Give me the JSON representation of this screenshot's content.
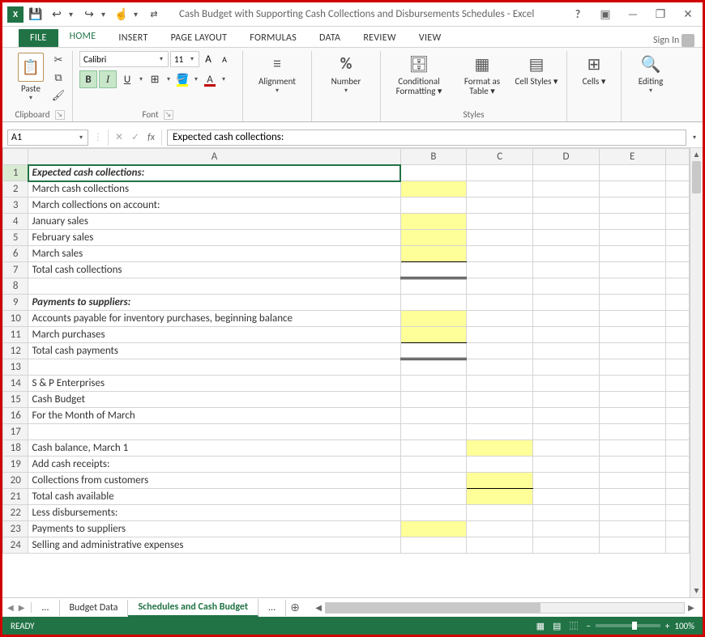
{
  "titlebar": {
    "doc_title": "Cash Budget with Supporting Cash Collections and Disbursements Schedules - Excel",
    "help": "?"
  },
  "ribbon": {
    "tabs": {
      "file": "FILE",
      "home": "HOME",
      "insert": "INSERT",
      "page_layout": "PAGE LAYOUT",
      "formulas": "FORMULAS",
      "data": "DATA",
      "review": "REVIEW",
      "view": "VIEW"
    },
    "sign_in": "Sign In",
    "clipboard": {
      "paste": "Paste",
      "label": "Clipboard"
    },
    "font": {
      "name": "Calibri",
      "size": "11",
      "label": "Font",
      "inc_a": "A",
      "dec_a": "A",
      "bold": "B",
      "italic": "I",
      "underline": "U"
    },
    "alignment": {
      "label": "Alignment"
    },
    "number": {
      "label": "Number",
      "percent": "%"
    },
    "styles": {
      "conditional": "Conditional Formatting ▾",
      "format_table": "Format as Table ▾",
      "cell_styles": "Cell Styles ▾",
      "label": "Styles"
    },
    "cells": {
      "label": "Cells",
      "btn": "Cells ▾"
    },
    "editing": {
      "label": "Editing",
      "btn": "Editing"
    }
  },
  "formula_bar": {
    "name_box": "A1",
    "fx": "fx",
    "value": "Expected cash collections:"
  },
  "columns": {
    "A": "A",
    "B": "B",
    "C": "C",
    "D": "D",
    "E": "E"
  },
  "rows_a": [
    "Expected cash collections:",
    "March cash collections",
    "March collections on account:",
    "January sales",
    "February sales",
    "March sales",
    "Total cash collections",
    "",
    "Payments to suppliers:",
    "Accounts payable for inventory purchases, beginning balance",
    "March purchases",
    "Total cash payments",
    "",
    "S & P Enterprises",
    "Cash Budget",
    "For the Month of March",
    "",
    "Cash balance, March 1",
    "Add cash receipts:",
    "Collections from customers",
    "Total cash available",
    "Less disbursements:",
    "Payments to suppliers",
    "Selling and administrative expenses"
  ],
  "row_numbers": [
    "1",
    "2",
    "3",
    "4",
    "5",
    "6",
    "7",
    "8",
    "9",
    "10",
    "11",
    "12",
    "13",
    "14",
    "15",
    "16",
    "17",
    "18",
    "19",
    "20",
    "21",
    "22",
    "23",
    "24"
  ],
  "sheet_tabs": {
    "ellipsis": "...",
    "t1": "Budget Data",
    "t2": "Schedules and Cash Budget",
    "more": "...",
    "add": "⊕"
  },
  "statusbar": {
    "ready": "READY",
    "zoom": "100%",
    "minus": "−",
    "plus": "+"
  }
}
